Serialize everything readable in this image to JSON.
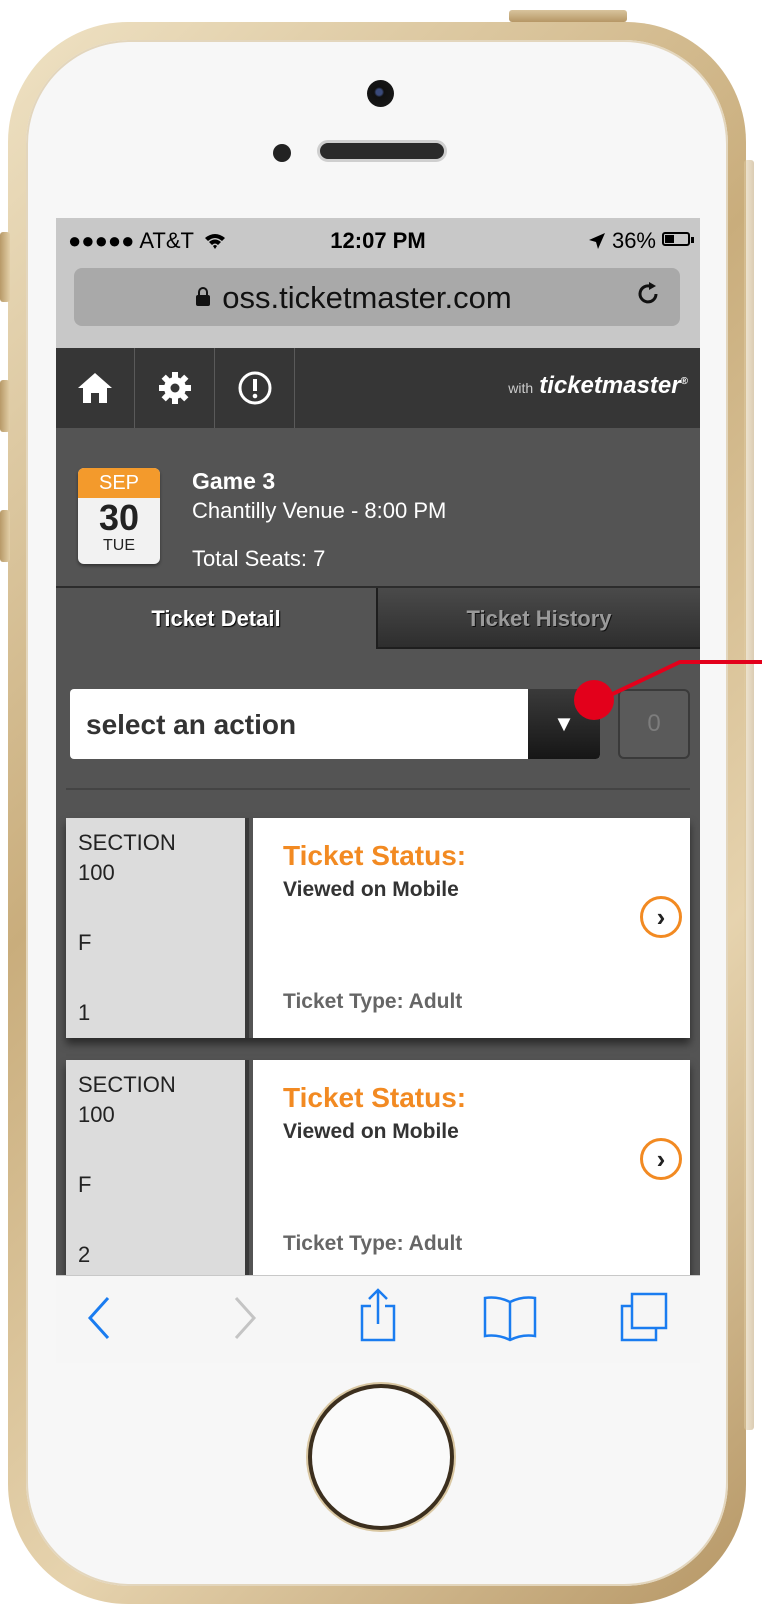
{
  "status_bar": {
    "carrier": "●●●●● AT&T",
    "wifi_icon": "wifi-icon",
    "time": "12:07 PM",
    "location_icon": "location-arrow-icon",
    "battery": "36%",
    "battery_level": 0.36
  },
  "browser": {
    "url": "oss.ticketmaster.com"
  },
  "nav": {
    "brand_prefix": "with",
    "brand": "ticketmaster",
    "brand_mark": "®"
  },
  "event": {
    "month": "SEP",
    "day": "30",
    "weekday": "TUE",
    "title": "Game 3",
    "venue_time": "Chantilly Venue - 8:00 PM",
    "seats": "Total Seats: 7"
  },
  "tabs": [
    {
      "label": "Ticket Detail",
      "active": true
    },
    {
      "label": "Ticket History",
      "active": false
    }
  ],
  "action": {
    "placeholder": "select an action",
    "arrow": "▼",
    "count": "0"
  },
  "tickets": [
    {
      "section_label": "SECTION",
      "section": "100",
      "row": "F",
      "seat": "1",
      "status_label": "Ticket Status:",
      "status": "Viewed on Mobile",
      "type": "Ticket Type: Adult"
    },
    {
      "section_label": "SECTION",
      "section": "100",
      "row": "F",
      "seat": "2",
      "status_label": "Ticket Status:",
      "status": "Viewed on Mobile",
      "type": "Ticket Type: Adult"
    }
  ],
  "colors": {
    "accent": "#f28a22",
    "calendar": "#f39a2c",
    "annotation": "#e3001b",
    "ios_blue": "#1a7cf0"
  }
}
